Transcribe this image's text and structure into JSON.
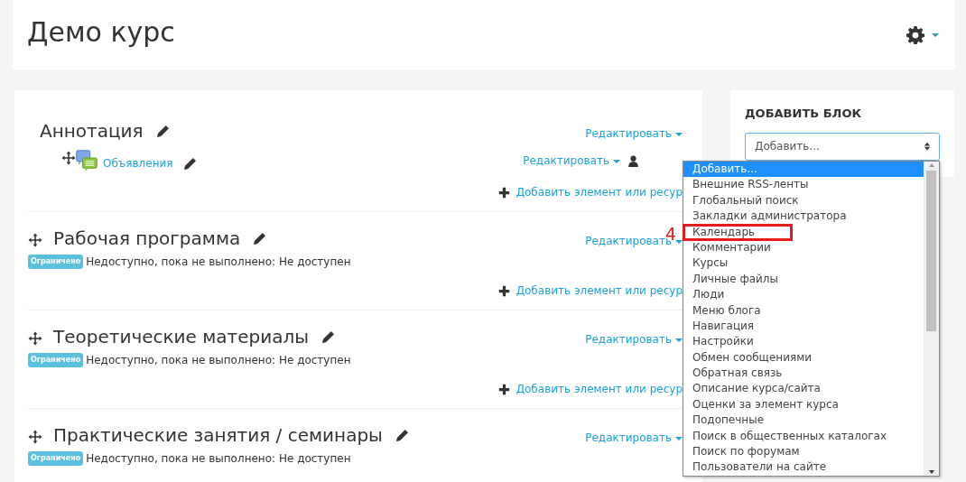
{
  "page_header": {
    "title": "Демо курс"
  },
  "sections": [
    {
      "title": "Аннотация",
      "movable": false,
      "edit_menu": "Редактировать",
      "modules": [
        {
          "name": "Объявления",
          "edit_menu": "Редактировать"
        }
      ],
      "add_link": "Добавить элемент или ресур"
    },
    {
      "title": "Рабочая программа",
      "movable": true,
      "edit_menu": "Редактировать",
      "restricted": {
        "badge": "Ограничено",
        "text": "Недоступно, пока не выполнено: Не доступен"
      },
      "add_link": "Добавить элемент или ресур"
    },
    {
      "title": "Теоретические материалы",
      "movable": true,
      "edit_menu": "Редактировать",
      "restricted": {
        "badge": "Ограничено",
        "text": "Недоступно, пока не выполнено: Не доступен"
      },
      "add_link": "Добавить элемент или ресур"
    },
    {
      "title": "Практические занятия / семинары",
      "movable": true,
      "edit_menu": "Редактировать",
      "restricted": {
        "badge": "Ограничено",
        "text": "Недоступно, пока не выполнено: Не доступен"
      }
    }
  ],
  "add_block": {
    "title": "ДОБАВИТЬ БЛОК",
    "select_value": "Добавить...",
    "options": [
      {
        "label": "Добавить...",
        "selected": true,
        "highlighted": false
      },
      {
        "label": "Внешние RSS-ленты",
        "selected": false,
        "highlighted": false
      },
      {
        "label": "Глобальный поиск",
        "selected": false,
        "highlighted": false
      },
      {
        "label": "Закладки администратора",
        "selected": false,
        "highlighted": false
      },
      {
        "label": "Календарь",
        "selected": false,
        "highlighted": true
      },
      {
        "label": "Комментарии",
        "selected": false,
        "highlighted": false
      },
      {
        "label": "Курсы",
        "selected": false,
        "highlighted": false
      },
      {
        "label": "Личные файлы",
        "selected": false,
        "highlighted": false
      },
      {
        "label": "Люди",
        "selected": false,
        "highlighted": false
      },
      {
        "label": "Меню блога",
        "selected": false,
        "highlighted": false
      },
      {
        "label": "Навигация",
        "selected": false,
        "highlighted": false
      },
      {
        "label": "Настройки",
        "selected": false,
        "highlighted": false
      },
      {
        "label": "Обмен сообщениями",
        "selected": false,
        "highlighted": false
      },
      {
        "label": "Обратная связь",
        "selected": false,
        "highlighted": false
      },
      {
        "label": "Описание курса/сайта",
        "selected": false,
        "highlighted": false
      },
      {
        "label": "Оценки за элемент курса",
        "selected": false,
        "highlighted": false
      },
      {
        "label": "Подопечные",
        "selected": false,
        "highlighted": false
      },
      {
        "label": "Поиск в общественных каталогах",
        "selected": false,
        "highlighted": false
      },
      {
        "label": "Поиск по форумам",
        "selected": false,
        "highlighted": false
      },
      {
        "label": "Пользователи на сайте",
        "selected": false,
        "highlighted": false
      }
    ]
  },
  "annotation": {
    "label": "4"
  }
}
